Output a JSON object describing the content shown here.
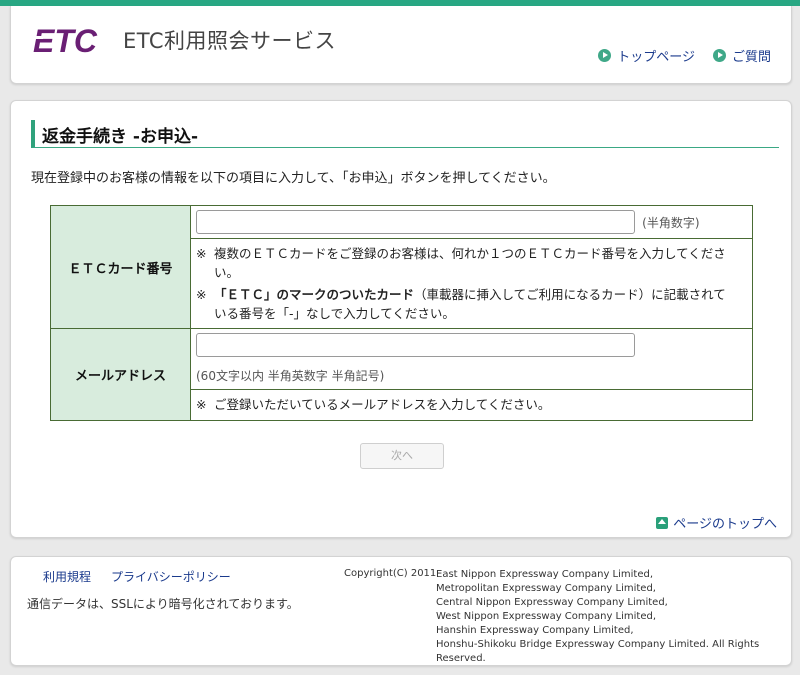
{
  "header": {
    "logo_mark": "ETC",
    "logo_text": "ETC利用照会サービス",
    "links": [
      {
        "label": "トップページ",
        "icon": "arrow-right-circle-icon"
      },
      {
        "label": "ご質問",
        "icon": "arrow-right-circle-icon"
      }
    ]
  },
  "page": {
    "title": "返金手続き -お申込-",
    "intro": "現在登録中のお客様の情報を以下の項目に入力して、「お申込」ボタンを押してください。"
  },
  "form": {
    "card": {
      "label": "ＥＴＣカード番号",
      "value": "",
      "hint": "(半角数字)",
      "note1_mark": "※",
      "note1": "複数のＥＴＣカードをご登録のお客様は、何れか１つのＥＴＣカード番号を入力してください。",
      "note2_mark": "※",
      "note2_bold": "「ＥＴＣ」のマークのついたカード",
      "note2_rest": "（車載器に挿入してご利用になるカード）に記載されている番号を「-」なしで入力してください。"
    },
    "email": {
      "label": "メールアドレス",
      "value": "",
      "hint": "(60文字以内 半角英数字 半角記号)",
      "note_mark": "※",
      "note": "ご登録いただいているメールアドレスを入力してください。"
    },
    "next_label": "次へ"
  },
  "pagetop": {
    "label": "ページのトップへ",
    "icon": "arrow-up-icon"
  },
  "footer": {
    "links": [
      "利用規程",
      "プライバシーポリシー"
    ],
    "ssl": "通信データは、SSLにより暗号化されております。",
    "copyright": "Copyright(C) 2011",
    "companies": [
      "East Nippon Expressway Company Limited,",
      "Metropolitan Expressway Company Limited,",
      "Central Nippon Expressway Company Limited,",
      "West Nippon Expressway Company Limited,",
      "Hanshin Expressway Company Limited,",
      "Honshu-Shikoku Bridge Expressway Company Limited. All Rights Reserved."
    ]
  },
  "colors": {
    "accent": "#28a783",
    "logo": "#6a1f74",
    "link": "#1a3a8c",
    "header_cell": "#d8ecdd"
  }
}
